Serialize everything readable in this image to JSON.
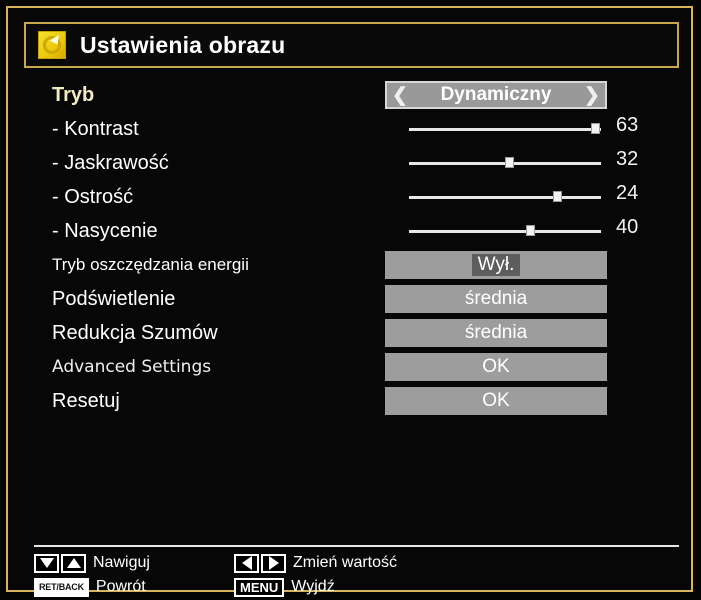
{
  "window": {
    "title": "Ustawienia obrazu",
    "icon": "picture-settings-icon",
    "frame_color": "#d8b55a",
    "background_color": "#050505"
  },
  "menu": {
    "rows": [
      {
        "key": "mode",
        "label": "Tryb",
        "selected": true,
        "control": "option",
        "value": "Dynamiczny",
        "prev_icon": "chevron-left-icon",
        "next_icon": "chevron-right-icon"
      },
      {
        "key": "contrast",
        "label": "- Kontrast",
        "selected": false,
        "control": "slider",
        "value": "63",
        "knob_percent": 97
      },
      {
        "key": "brightness",
        "label": "- Jaskrawość",
        "selected": false,
        "control": "slider",
        "value": "32",
        "knob_percent": 52
      },
      {
        "key": "sharpness",
        "label": "- Ostrość",
        "selected": false,
        "control": "slider",
        "value": "24",
        "knob_percent": 77
      },
      {
        "key": "saturation",
        "label": "- Nasycenie",
        "selected": false,
        "control": "slider",
        "value": "40",
        "knob_percent": 63
      },
      {
        "key": "power-save-mode",
        "label": "Tryb oszczędzania energii",
        "selected": false,
        "control": "value-box",
        "value": "Wył.",
        "highlighted": true
      },
      {
        "key": "backlight",
        "label": "Podświetlenie",
        "selected": false,
        "control": "value-box",
        "value": "średnia",
        "highlighted": false
      },
      {
        "key": "noise-reduction",
        "label": "Redukcja Szumów",
        "selected": false,
        "control": "value-box",
        "value": "średnia",
        "highlighted": false
      },
      {
        "key": "advanced-settings",
        "label": "Advanced Settings",
        "selected": false,
        "latin_font": true,
        "control": "value-box",
        "value": "OK",
        "highlighted": false
      },
      {
        "key": "reset",
        "label": "Resetuj",
        "selected": false,
        "control": "value-box",
        "value": "OK",
        "highlighted": false
      }
    ]
  },
  "footer": {
    "hints": [
      {
        "key": "navigate",
        "keys": [
          "arrow-down",
          "arrow-up"
        ],
        "label": "Nawiguj"
      },
      {
        "key": "change-value",
        "keys": [
          "arrow-left",
          "arrow-right"
        ],
        "label": "Zmień wartość"
      },
      {
        "key": "back",
        "keys": [
          "RET/BACK"
        ],
        "label": "Powrót"
      },
      {
        "key": "exit",
        "keys": [
          "MENU"
        ],
        "label": "Wyjdź"
      }
    ]
  }
}
